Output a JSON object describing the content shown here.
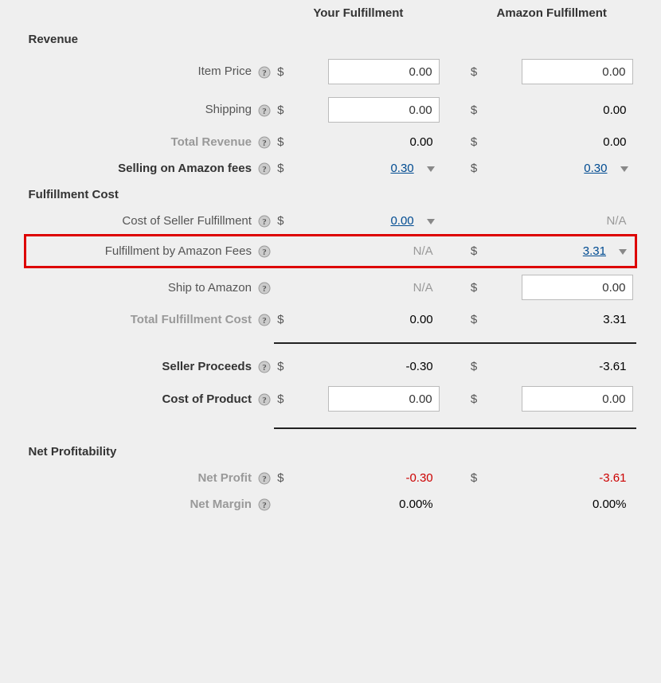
{
  "columns": {
    "your": "Your Fulfillment",
    "amazon": "Amazon Fulfillment"
  },
  "sections": {
    "revenue": "Revenue",
    "fulfillment_cost": "Fulfillment Cost",
    "net_profitability": "Net Profitability"
  },
  "rows": {
    "item_price": {
      "label": "Item Price",
      "currency": "$",
      "your": {
        "type": "input",
        "value": "0.00"
      },
      "amazon": {
        "type": "input",
        "value": "0.00"
      }
    },
    "shipping": {
      "label": "Shipping",
      "currency": "$",
      "your": {
        "type": "input",
        "value": "0.00"
      },
      "amazon": {
        "type": "static",
        "value": "0.00"
      }
    },
    "total_revenue": {
      "label": "Total Revenue",
      "currency": "$",
      "your": {
        "type": "static",
        "value": "0.00"
      },
      "amazon": {
        "type": "static",
        "value": "0.00"
      }
    },
    "selling_fees": {
      "label": "Selling on Amazon fees",
      "currency": "$",
      "your": {
        "type": "link",
        "value": "0.30",
        "dropdown": true
      },
      "amazon": {
        "type": "link",
        "value": "0.30",
        "dropdown": true
      }
    },
    "seller_fulfillment": {
      "label": "Cost of Seller Fulfillment",
      "currency": "$",
      "your": {
        "type": "link",
        "value": "0.00",
        "dropdown": true
      },
      "amazon": {
        "type": "na",
        "value": "N/A"
      }
    },
    "fba_fees": {
      "label": "Fulfillment by Amazon Fees",
      "currency": "$",
      "your": {
        "type": "na",
        "value": "N/A"
      },
      "amazon": {
        "type": "link",
        "value": "3.31",
        "dropdown": true
      }
    },
    "ship_to_amazon": {
      "label": "Ship to Amazon",
      "currency": "$",
      "your": {
        "type": "na",
        "value": "N/A"
      },
      "amazon": {
        "type": "input",
        "value": "0.00"
      }
    },
    "total_fulfillment": {
      "label": "Total Fulfillment Cost",
      "currency": "$",
      "your": {
        "type": "static",
        "value": "0.00"
      },
      "amazon": {
        "type": "static",
        "value": "3.31"
      }
    },
    "seller_proceeds": {
      "label": "Seller Proceeds",
      "currency": "$",
      "your": {
        "type": "static",
        "value": "-0.30"
      },
      "amazon": {
        "type": "static",
        "value": "-3.61"
      }
    },
    "cost_of_product": {
      "label": "Cost of Product",
      "currency": "$",
      "your": {
        "type": "input",
        "value": "0.00"
      },
      "amazon": {
        "type": "input",
        "value": "0.00"
      }
    },
    "net_profit": {
      "label": "Net Profit",
      "currency": "$",
      "your": {
        "type": "static",
        "value": "-0.30",
        "neg": true
      },
      "amazon": {
        "type": "static",
        "value": "-3.61",
        "neg": true
      }
    },
    "net_margin": {
      "label": "Net Margin",
      "your": {
        "type": "static",
        "value": "0.00%"
      },
      "amazon": {
        "type": "static",
        "value": "0.00%"
      }
    }
  }
}
